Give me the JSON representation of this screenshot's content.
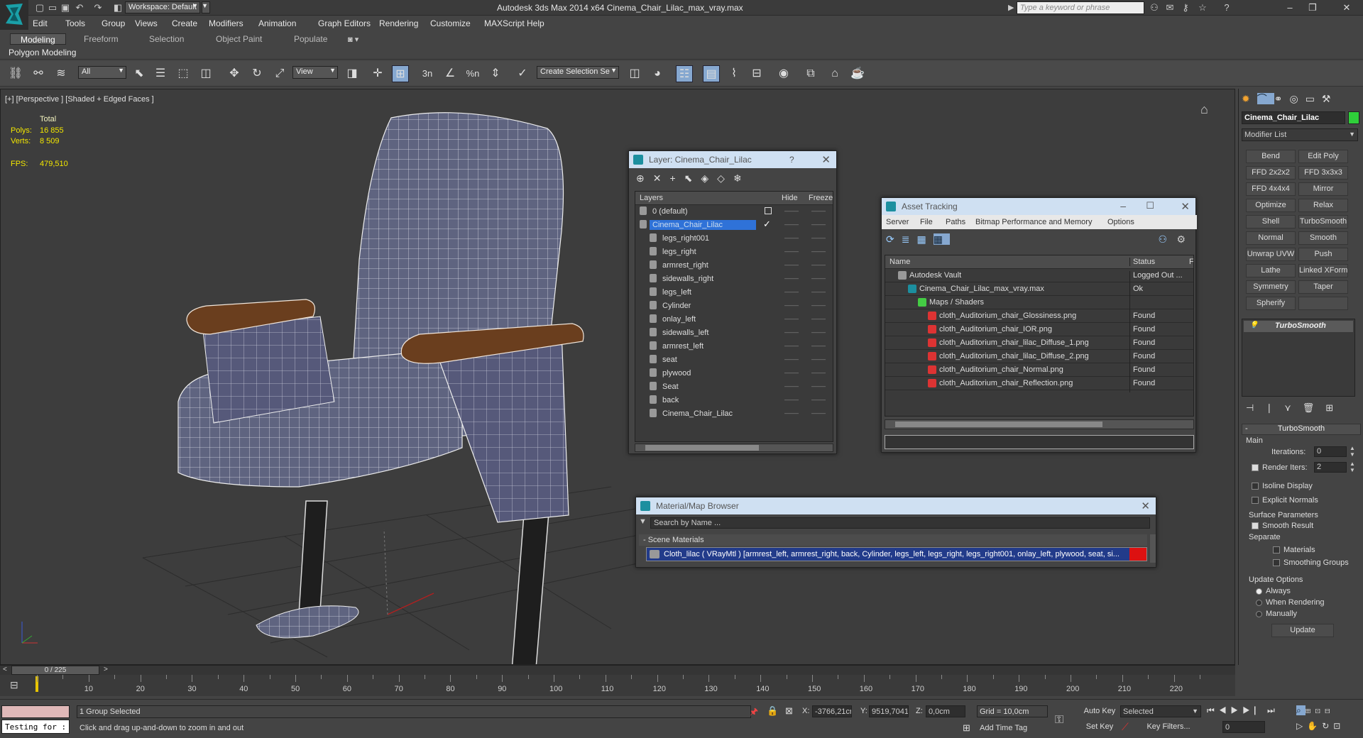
{
  "app": {
    "title": "Autodesk 3ds Max  2014 x64     Cinema_Chair_Lilac_max_vray.max",
    "workspace": "Workspace: Default",
    "search_placeholder": "Type a keyword or phrase"
  },
  "menu": [
    "Edit",
    "Tools",
    "Group",
    "Views",
    "Create",
    "Modifiers",
    "Animation",
    "Graph Editors",
    "Rendering",
    "Customize",
    "MAXScript",
    "Help"
  ],
  "ribbon": {
    "tabs": [
      "Modeling",
      "Freeform",
      "Selection",
      "Object Paint",
      "Populate"
    ],
    "active_tab": "Modeling",
    "sub_label": "Polygon Modeling"
  },
  "toolbar": {
    "filter": "All",
    "coord": "View",
    "selection_set": "Create Selection Se",
    "snap_label": "3"
  },
  "viewport": {
    "label": "[+] [Perspective ] [Shaded + Edged Faces ]",
    "stats": {
      "total_label": "Total",
      "polys_label": "Polys:",
      "polys": "16 855",
      "verts_label": "Verts:",
      "verts": "8 509",
      "fps_label": "FPS:",
      "fps": "479,510"
    }
  },
  "layer_dialog": {
    "title": "Layer: Cinema_Chair_Lilac",
    "help": "?",
    "col_layers": "Layers",
    "col_hide": "Hide",
    "col_freeze": "Freeze",
    "rows": [
      {
        "name": "0 (default)",
        "level": 0,
        "selected": false
      },
      {
        "name": "Cinema_Chair_Lilac",
        "level": 0,
        "selected": true
      },
      {
        "name": "legs_right001",
        "level": 1,
        "selected": false
      },
      {
        "name": "legs_right",
        "level": 1,
        "selected": false
      },
      {
        "name": "armrest_right",
        "level": 1,
        "selected": false
      },
      {
        "name": "sidewalls_right",
        "level": 1,
        "selected": false
      },
      {
        "name": "legs_left",
        "level": 1,
        "selected": false
      },
      {
        "name": "Cylinder",
        "level": 1,
        "selected": false
      },
      {
        "name": "onlay_left",
        "level": 1,
        "selected": false
      },
      {
        "name": "sidewalls_left",
        "level": 1,
        "selected": false
      },
      {
        "name": "armrest_left",
        "level": 1,
        "selected": false
      },
      {
        "name": "seat",
        "level": 1,
        "selected": false
      },
      {
        "name": "plywood",
        "level": 1,
        "selected": false
      },
      {
        "name": "Seat",
        "level": 1,
        "selected": false
      },
      {
        "name": "back",
        "level": 1,
        "selected": false
      },
      {
        "name": "Cinema_Chair_Lilac",
        "level": 1,
        "selected": false
      }
    ]
  },
  "asset_dialog": {
    "title": "Asset Tracking",
    "menu": [
      "Server",
      "File",
      "Paths",
      "Bitmap Performance and Memory",
      "Options"
    ],
    "col_name": "Name",
    "col_status": "Status",
    "col_extra": "F",
    "rows": [
      {
        "name": "Autodesk Vault",
        "status": "Logged Out ...",
        "level": 0,
        "icon": "vault-icon"
      },
      {
        "name": "Cinema_Chair_Lilac_max_vray.max",
        "status": "Ok",
        "level": 1,
        "icon": "max-file-icon"
      },
      {
        "name": "Maps / Shaders",
        "status": "",
        "level": 2,
        "icon": "folder-icon"
      },
      {
        "name": "cloth_Auditorium_chair_Glossiness.png",
        "status": "Found",
        "level": 3,
        "icon": "png-icon"
      },
      {
        "name": "cloth_Auditorium_chair_IOR.png",
        "status": "Found",
        "level": 3,
        "icon": "png-icon"
      },
      {
        "name": "cloth_Auditorium_chair_lilac_Diffuse_1.png",
        "status": "Found",
        "level": 3,
        "icon": "png-icon"
      },
      {
        "name": "cloth_Auditorium_chair_lilac_Diffuse_2.png",
        "status": "Found",
        "level": 3,
        "icon": "png-icon"
      },
      {
        "name": "cloth_Auditorium_chair_Normal.png",
        "status": "Found",
        "level": 3,
        "icon": "png-icon"
      },
      {
        "name": "cloth_Auditorium_chair_Reflection.png",
        "status": "Found",
        "level": 3,
        "icon": "png-icon"
      }
    ]
  },
  "material_browser": {
    "title": "Material/Map Browser",
    "search_placeholder": "Search by Name ...",
    "section": "- Scene Materials",
    "item": "Cloth_lilac ( VRayMtl ) [armrest_left, armrest_right, back, Cylinder, legs_left, legs_right, legs_right001, onlay_left, plywood, seat, si..."
  },
  "command_panel": {
    "object_name": "Cinema_Chair_Lilac",
    "modifier_list": "Modifier List",
    "buttons": [
      "Bend",
      "Edit Poly",
      "FFD 2x2x2",
      "FFD 3x3x3",
      "FFD 4x4x4",
      "Mirror",
      "Optimize",
      "Relax",
      "Shell",
      "TurboSmooth",
      "Normal",
      "Smooth",
      "Unwrap UVW",
      "Push",
      "Lathe",
      "Linked XForm",
      "Symmetry",
      "Taper",
      "Spherify",
      ""
    ],
    "stack_item": "TurboSmooth",
    "rollout_title": "TurboSmooth",
    "main_label": "Main",
    "iterations_label": "Iterations:",
    "iterations": "0",
    "render_iters_label": "Render Iters:",
    "render_iters": "2",
    "isoline": "Isoline Display",
    "explicit": "Explicit Normals",
    "surface_label": "Surface Parameters",
    "smooth_result": "Smooth Result",
    "separate_label": "Separate",
    "materials": "Materials",
    "smoothing_groups": "Smoothing Groups",
    "update_label": "Update Options",
    "always": "Always",
    "when_rendering": "When Rendering",
    "manually": "Manually",
    "update_btn": "Update"
  },
  "timeline": {
    "frame": "0 / 225",
    "prev": "<",
    "next": ">",
    "ticks": [
      "10",
      "20",
      "30",
      "40",
      "50",
      "60",
      "70",
      "80",
      "90",
      "100",
      "110",
      "120",
      "130",
      "140",
      "150",
      "160",
      "170",
      "180",
      "190",
      "200",
      "210",
      "220"
    ]
  },
  "status": {
    "maxscript": "Testing for :",
    "selected": "1 Group Selected",
    "prompt": "Click and drag up-and-down to zoom in and out",
    "x_label": "X:",
    "x": "-3766,21cr",
    "y_label": "Y:",
    "y": "9519,7041",
    "z_label": "Z:",
    "z": "0,0cm",
    "grid": "Grid = 10,0cm",
    "add_time_tag": "Add Time Tag",
    "auto_key": "Auto Key",
    "set_key": "Set Key",
    "selected_combo": "Selected",
    "key_filters": "Key Filters...",
    "frame_field": "0"
  }
}
